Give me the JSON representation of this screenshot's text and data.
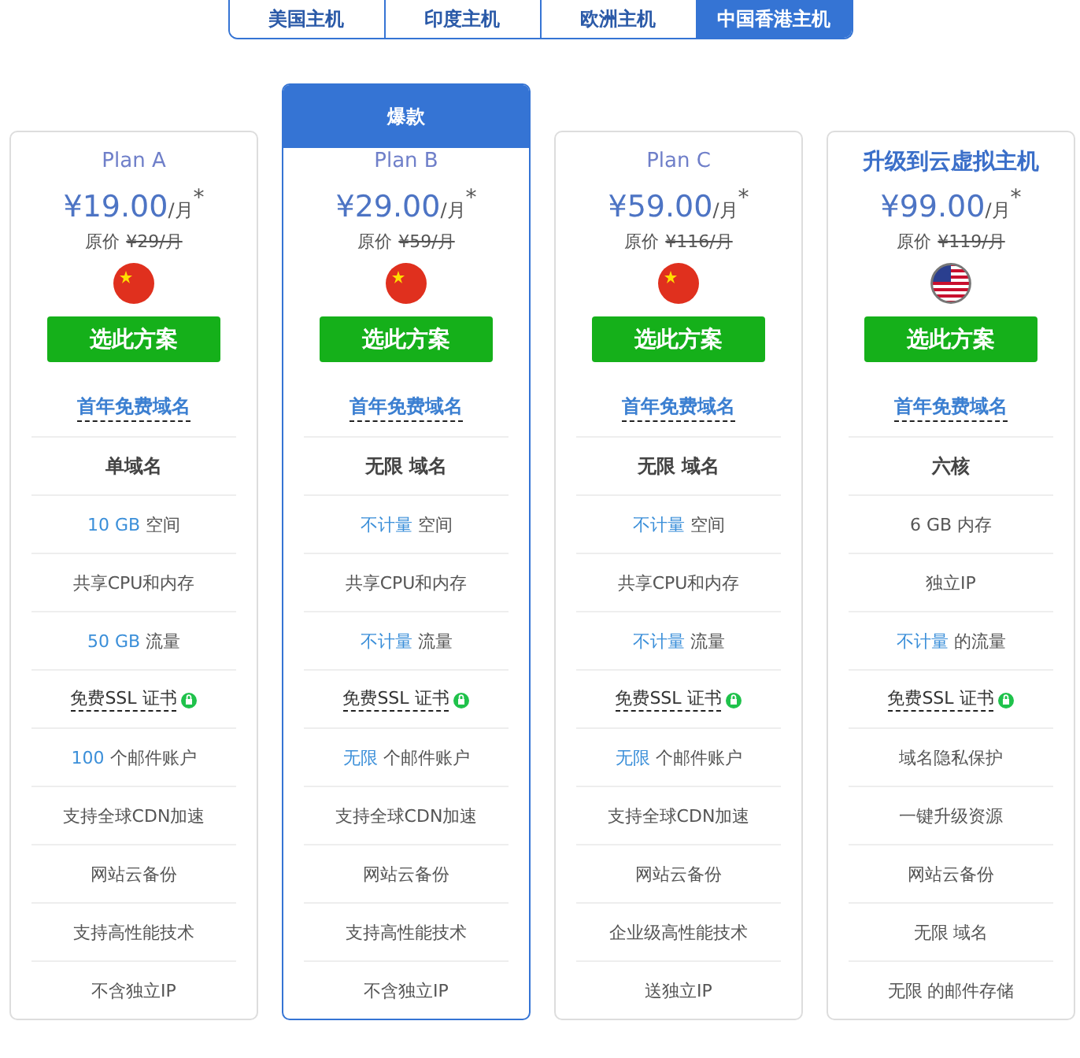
{
  "tabs": [
    {
      "label": "美国主机",
      "selected": false
    },
    {
      "label": "印度主机",
      "selected": false
    },
    {
      "label": "欧洲主机",
      "selected": false
    },
    {
      "label": "中国香港主机",
      "selected": true
    }
  ],
  "plans": [
    {
      "featured": false,
      "title": "Plan A",
      "emphasized": false,
      "price": "¥19.00",
      "unit": "/月",
      "mark": "*",
      "original_label": "原价",
      "original_price": "¥29/月",
      "flag": {
        "kind": "cn"
      },
      "button": "选此方案",
      "features": [
        {
          "kind": "link",
          "text": "首年免费域名"
        },
        {
          "kind": "bold",
          "text": "单域名"
        },
        {
          "kind": "plain",
          "accent": "10 GB",
          "text": "空间"
        },
        {
          "kind": "plain",
          "text": "共享CPU和内存"
        },
        {
          "kind": "plain",
          "accent": "50 GB",
          "text": "流量"
        },
        {
          "kind": "ssl",
          "text": "免费SSL 证书"
        },
        {
          "kind": "plain",
          "accent": "100",
          "text": "个邮件账户"
        },
        {
          "kind": "plain",
          "text": "支持全球CDN加速"
        },
        {
          "kind": "plain",
          "text": "网站云备份"
        },
        {
          "kind": "plain",
          "text": "支持高性能技术"
        },
        {
          "kind": "plain",
          "text": "不含独立IP"
        }
      ]
    },
    {
      "featured": true,
      "badge": "爆款",
      "title": "Plan B",
      "emphasized": false,
      "price": "¥29.00",
      "unit": "/月",
      "mark": "*",
      "original_label": "原价",
      "original_price": "¥59/月",
      "flag": {
        "kind": "cn"
      },
      "button": "选此方案",
      "features": [
        {
          "kind": "link",
          "text": "首年免费域名"
        },
        {
          "kind": "bold",
          "text": "无限 域名"
        },
        {
          "kind": "plain",
          "accent": "不计量",
          "text": "空间"
        },
        {
          "kind": "plain",
          "text": "共享CPU和内存"
        },
        {
          "kind": "plain",
          "accent": "不计量",
          "text": "流量"
        },
        {
          "kind": "ssl",
          "text": "免费SSL 证书"
        },
        {
          "kind": "plain",
          "accent": "无限",
          "text": "个邮件账户"
        },
        {
          "kind": "plain",
          "text": "支持全球CDN加速"
        },
        {
          "kind": "plain",
          "text": "网站云备份"
        },
        {
          "kind": "plain",
          "text": "支持高性能技术"
        },
        {
          "kind": "plain",
          "text": "不含独立IP"
        }
      ]
    },
    {
      "featured": false,
      "title": "Plan C",
      "emphasized": false,
      "price": "¥59.00",
      "unit": "/月",
      "mark": "*",
      "original_label": "原价",
      "original_price": "¥116/月",
      "flag": {
        "kind": "cn"
      },
      "button": "选此方案",
      "features": [
        {
          "kind": "link",
          "text": "首年免费域名"
        },
        {
          "kind": "bold",
          "text": "无限 域名"
        },
        {
          "kind": "plain",
          "accent": "不计量",
          "text": "空间"
        },
        {
          "kind": "plain",
          "text": "共享CPU和内存"
        },
        {
          "kind": "plain",
          "accent": "不计量",
          "text": "流量"
        },
        {
          "kind": "ssl",
          "text": "免费SSL 证书"
        },
        {
          "kind": "plain",
          "accent": "无限",
          "text": "个邮件账户"
        },
        {
          "kind": "plain",
          "text": "支持全球CDN加速"
        },
        {
          "kind": "plain",
          "text": "网站云备份"
        },
        {
          "kind": "plain",
          "text": "企业级高性能技术"
        },
        {
          "kind": "plain",
          "text": "送独立IP"
        }
      ]
    },
    {
      "featured": false,
      "title": "升级到云虚拟主机",
      "emphasized": true,
      "price": "¥99.00",
      "unit": "/月",
      "mark": "*",
      "original_label": "原价",
      "original_price": "¥119/月",
      "flag": {
        "kind": "us"
      },
      "button": "选此方案",
      "features": [
        {
          "kind": "link",
          "text": "首年免费域名"
        },
        {
          "kind": "bold",
          "text": "六核"
        },
        {
          "kind": "plain",
          "text": "6 GB 内存"
        },
        {
          "kind": "plain",
          "text": "独立IP"
        },
        {
          "kind": "plain",
          "accent": "不计量",
          "text": "的流量"
        },
        {
          "kind": "ssl",
          "text": "免费SSL 证书"
        },
        {
          "kind": "plain",
          "text": "域名隐私保护"
        },
        {
          "kind": "plain",
          "text": "一键升级资源"
        },
        {
          "kind": "plain",
          "text": "网站云备份"
        },
        {
          "kind": "plain",
          "text": "无限 域名"
        },
        {
          "kind": "plain",
          "text": "无限 的邮件存储"
        }
      ]
    }
  ]
}
